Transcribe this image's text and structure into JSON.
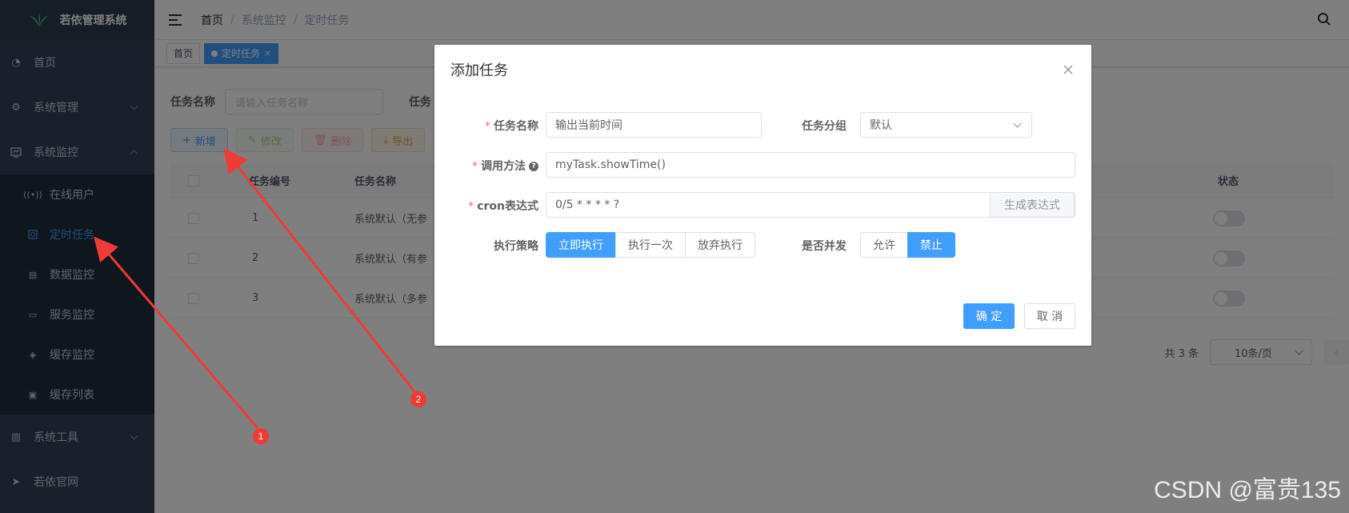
{
  "sidebar": {
    "logo_text": "若依管理系统",
    "menu": [
      {
        "label": "首页",
        "icon": "dashboard-icon"
      },
      {
        "label": "系统管理",
        "icon": "gear-icon"
      },
      {
        "label": "系统监控",
        "icon": "monitor-icon"
      },
      {
        "label": "系统工具",
        "icon": "toolbox-icon"
      },
      {
        "label": "若依官网",
        "icon": "send-icon"
      }
    ],
    "submenu": [
      {
        "label": "在线用户",
        "icon": "online-icon"
      },
      {
        "label": "定时任务",
        "icon": "job-icon",
        "active": true
      },
      {
        "label": "数据监控",
        "icon": "database-icon"
      },
      {
        "label": "服务监控",
        "icon": "server-icon"
      },
      {
        "label": "缓存监控",
        "icon": "layers-icon"
      },
      {
        "label": "缓存列表",
        "icon": "display-icon"
      }
    ]
  },
  "navbar": {
    "breadcrumb": [
      "首页",
      "系统监控",
      "定时任务"
    ],
    "sep": "/"
  },
  "tags": [
    {
      "label": "首页",
      "active": false
    },
    {
      "label": "定时任务",
      "active": true,
      "close": "×"
    }
  ],
  "search": {
    "label": "任务名称",
    "placeholder": "请输入任务名称",
    "label2": "任务"
  },
  "toolbar": {
    "add": "新增",
    "edit": "修改",
    "delete": "删除",
    "export": "导出",
    "add_icon": "+",
    "edit_icon": "✎",
    "delete_icon": "🗑",
    "export_icon": "⤓"
  },
  "table": {
    "headers": {
      "id": "任务编号",
      "name": "任务名称",
      "status": "状态"
    },
    "rows": [
      {
        "id": "1",
        "name": "系统默认（无参"
      },
      {
        "id": "2",
        "name": "系统默认（有参"
      },
      {
        "id": "3",
        "name": "系统默认（多参"
      }
    ]
  },
  "pager": {
    "total": "共 3 条",
    "page_size": "10条/页",
    "prev": "‹"
  },
  "dialog": {
    "title": "添加任务",
    "fields": {
      "name_label": "任务名称",
      "name_value": "输出当前时间",
      "group_label": "任务分组",
      "group_value": "默认",
      "invoke_label": "调用方法",
      "invoke_value": "myTask.showTime()",
      "cron_label": "cron表达式",
      "cron_value": "0/5 * * * * ?",
      "cron_btn": "生成表达式",
      "misfire_label": "执行策略",
      "misfire_options": [
        "立即执行",
        "执行一次",
        "放弃执行"
      ],
      "concurrent_label": "是否并发",
      "concurrent_options": [
        "允许",
        "禁止"
      ],
      "required_mark": "*",
      "help": "?"
    },
    "ok": "确 定",
    "cancel": "取 消"
  },
  "annotations": {
    "badge1": "1",
    "badge2": "2",
    "arrow_color": "#ef3b36"
  },
  "watermark": "CSDN @富贵135",
  "colors": {
    "sidebar": "#304156",
    "primary": "#409eff",
    "mask": "rgba(0,0,0,0.5)"
  }
}
